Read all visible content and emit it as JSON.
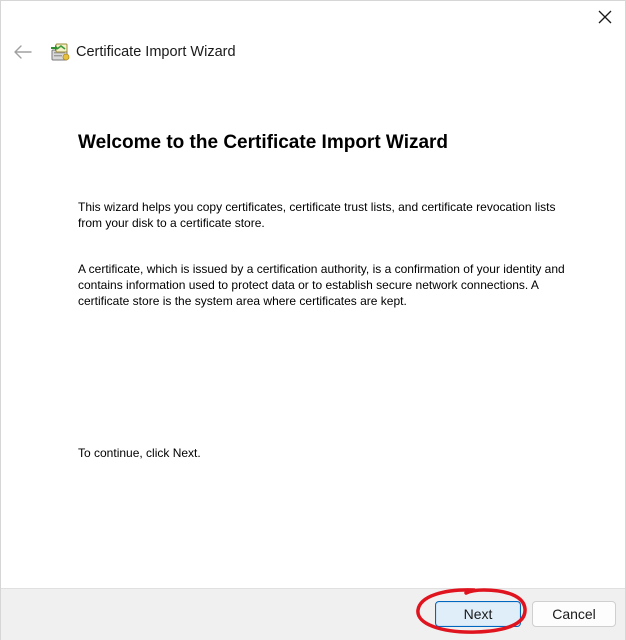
{
  "window": {
    "title": "Certificate Import Wizard"
  },
  "icons": {
    "close": "close-icon",
    "back": "back-arrow-icon",
    "wizard": "certificate-wizard-icon"
  },
  "content": {
    "heading": "Welcome to the Certificate Import Wizard",
    "paragraph1": "This wizard helps you copy certificates, certificate trust lists, and certificate revocation lists from your disk to a certificate store.",
    "paragraph2": "A certificate, which is issued by a certification authority, is a confirmation of your identity and contains information used to protect data or to establish secure network connections. A certificate store is the system area where certificates are kept.",
    "continue_text": "To continue, click Next."
  },
  "footer": {
    "next_label": "Next",
    "cancel_label": "Cancel"
  },
  "colors": {
    "accent": "#0067c0",
    "annotation": "#e0141e",
    "footer_bg": "#f0f0f0"
  }
}
